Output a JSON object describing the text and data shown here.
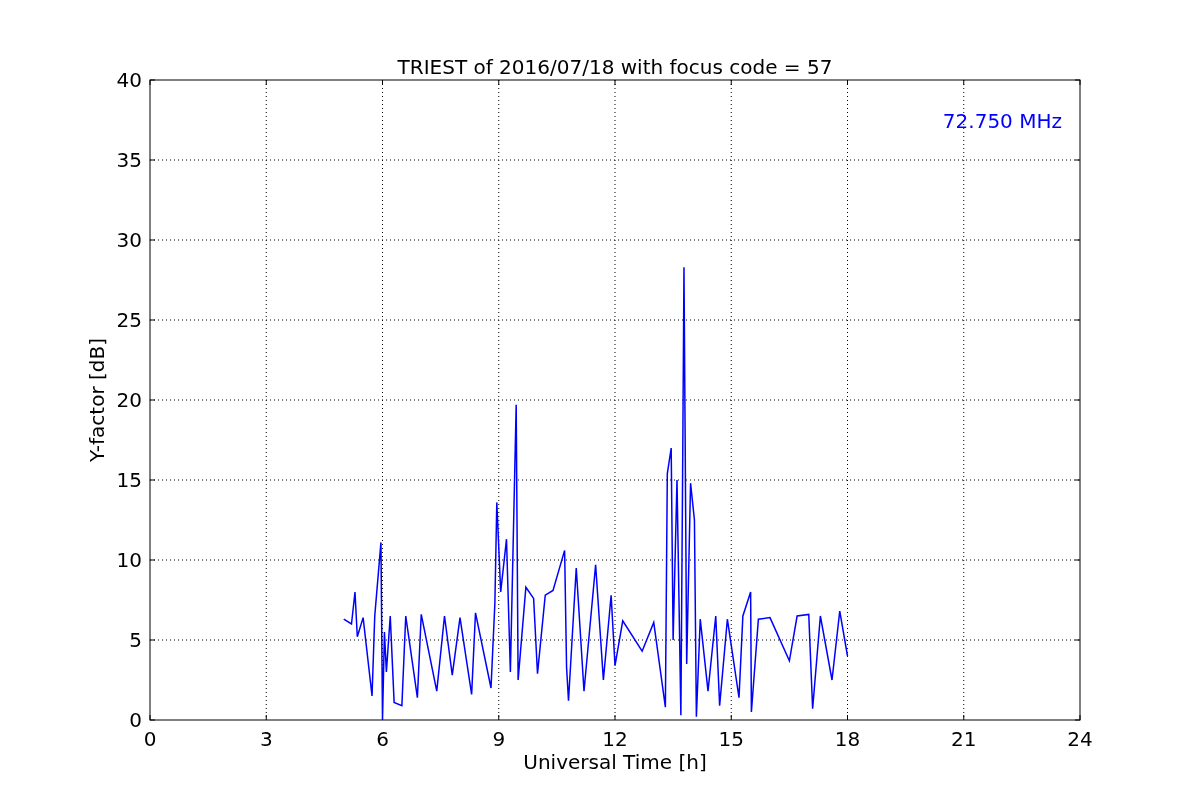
{
  "chart_data": {
    "type": "line",
    "title": "TRIEST of 2016/07/18 with focus code = 57",
    "xlabel": "Universal Time [h]",
    "ylabel": "Y-factor [dB]",
    "grid": true,
    "xlim": [
      0,
      24
    ],
    "ylim": [
      0,
      40
    ],
    "xticks": [
      0,
      3,
      6,
      9,
      12,
      15,
      18,
      21,
      24
    ],
    "yticks": [
      0,
      5,
      10,
      15,
      20,
      25,
      30,
      35,
      40
    ],
    "x": [
      5.0,
      5.2,
      5.29,
      5.35,
      5.5,
      5.73,
      5.8,
      5.96,
      6.0,
      6.05,
      6.1,
      6.2,
      6.3,
      6.5,
      6.6,
      6.9,
      7.0,
      7.4,
      7.6,
      7.8,
      8.0,
      8.3,
      8.4,
      8.8,
      8.9,
      8.95,
      9.05,
      9.2,
      9.3,
      9.45,
      9.5,
      9.7,
      9.9,
      10.0,
      10.2,
      10.4,
      10.7,
      10.75,
      10.8,
      11.0,
      11.2,
      11.5,
      11.7,
      11.9,
      12.0,
      12.2,
      12.7,
      13.0,
      13.3,
      13.35,
      13.45,
      13.5,
      13.6,
      13.7,
      13.75,
      13.78,
      13.85,
      13.95,
      14.05,
      14.1,
      14.2,
      14.4,
      14.6,
      14.7,
      14.9,
      15.2,
      15.3,
      15.5,
      15.52,
      15.7,
      16.0,
      16.5,
      16.7,
      17.0,
      17.1,
      17.3,
      17.6,
      17.8,
      18.0
    ],
    "series": [
      {
        "color": "#0000ff",
        "values": [
          6.3,
          6.0,
          8.0,
          5.2,
          6.4,
          1.5,
          6.5,
          11.1,
          0.0,
          5.5,
          3.0,
          6.5,
          1.1,
          0.9,
          6.5,
          1.4,
          6.6,
          1.8,
          6.5,
          2.8,
          6.4,
          1.6,
          6.7,
          2.0,
          7.3,
          13.6,
          8.0,
          11.3,
          3.0,
          19.7,
          2.5,
          8.3,
          7.6,
          2.9,
          7.8,
          8.1,
          10.6,
          3.3,
          1.2,
          9.5,
          1.8,
          9.7,
          2.5,
          7.8,
          3.4,
          6.2,
          4.3,
          6.1,
          0.8,
          15.4,
          17.0,
          5.0,
          15.0,
          0.3,
          17.2,
          28.3,
          3.5,
          14.8,
          12.5,
          0.2,
          6.3,
          1.8,
          6.5,
          0.9,
          6.3,
          1.4,
          6.5,
          8.0,
          0.5,
          6.3,
          6.4,
          3.7,
          6.5,
          6.6,
          0.7,
          6.5,
          2.5,
          6.8,
          4.0
        ]
      }
    ],
    "annotations": [
      {
        "text": "72.750 MHz"
      }
    ]
  }
}
